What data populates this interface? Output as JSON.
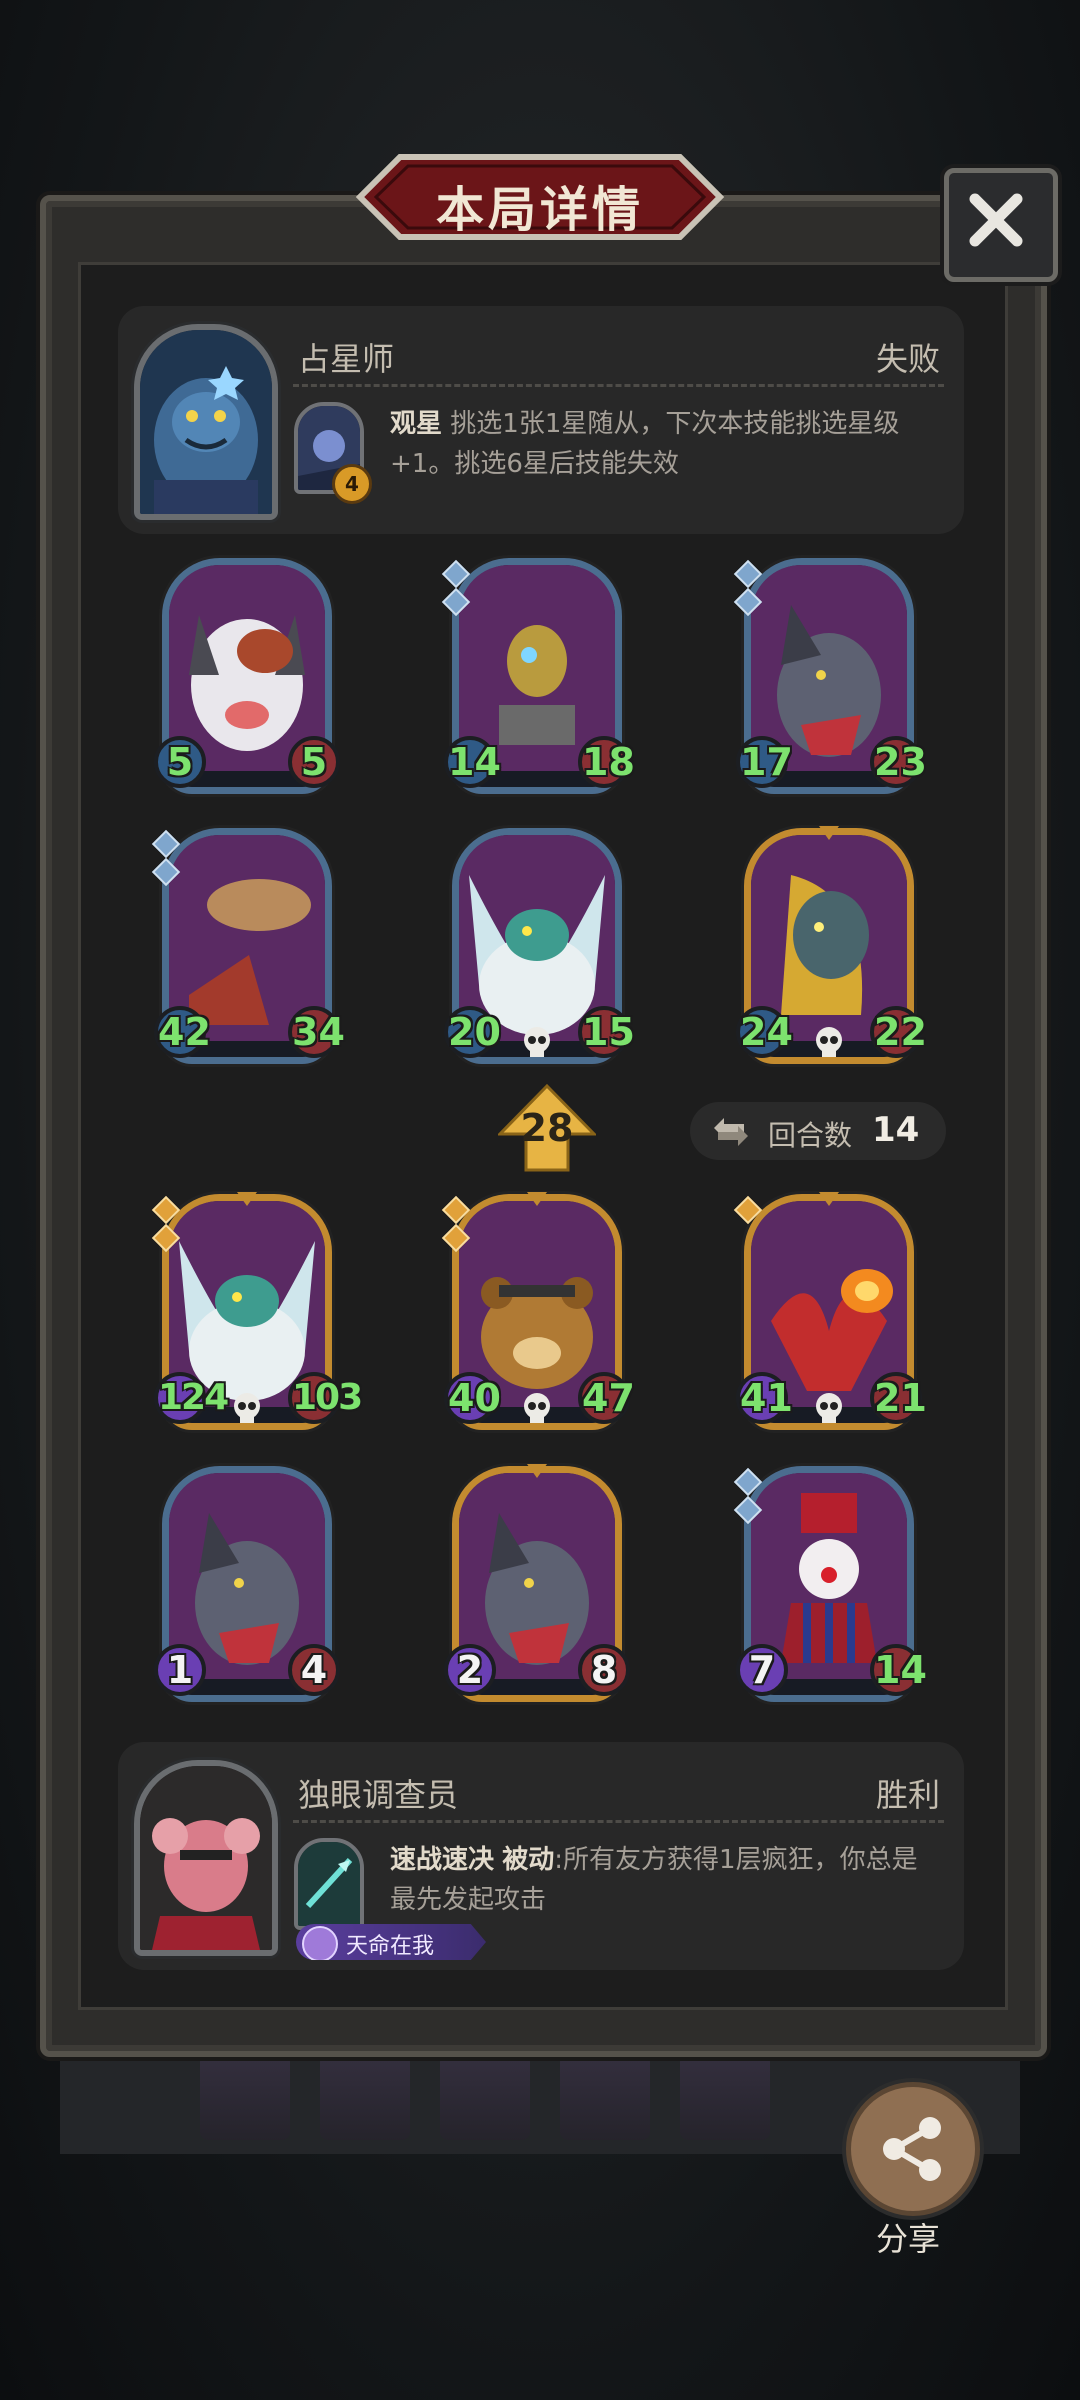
{
  "title": "本局详情",
  "opponent": {
    "name": "占星师",
    "result": "失败",
    "skill_name": "观星",
    "skill_desc": "挑选1张1星随从，下次本技能挑选星级+1。挑选6星后技能失效",
    "skill_level": "4"
  },
  "opponent_board": [
    {
      "atk": "5",
      "hp": "5",
      "frame": "blue",
      "gems": 0,
      "skull": false,
      "portrait": "wolf-dog"
    },
    {
      "atk": "14",
      "hp": "18",
      "frame": "blue",
      "gems": 2,
      "skull": false,
      "portrait": "robot-bug"
    },
    {
      "atk": "17",
      "hp": "23",
      "frame": "blue",
      "gems": 2,
      "skull": false,
      "portrait": "rat-bandit"
    },
    {
      "atk": "42",
      "hp": "34",
      "frame": "blue",
      "gems": 2,
      "skull": false,
      "portrait": "airship"
    },
    {
      "atk": "20",
      "hp": "15",
      "frame": "blue",
      "gems": 0,
      "skull": true,
      "portrait": "moth-yeti"
    },
    {
      "atk": "24",
      "hp": "22",
      "frame": "gold",
      "gems": 0,
      "skull": true,
      "portrait": "gold-dragon"
    }
  ],
  "arrow_value": "28",
  "rounds": {
    "label": "回合数",
    "value": "14"
  },
  "player_board": [
    {
      "atk": "124",
      "hp": "103",
      "frame": "gold",
      "gems": 2,
      "skull": true,
      "portrait": "moth-yeti"
    },
    {
      "atk": "40",
      "hp": "47",
      "frame": "gold",
      "gems": 2,
      "skull": true,
      "portrait": "bear"
    },
    {
      "atk": "41",
      "hp": "21",
      "frame": "gold",
      "gems": 1,
      "skull": true,
      "portrait": "fire-bat"
    },
    {
      "atk": "1",
      "hp": "4",
      "frame": "blue",
      "gems": 0,
      "skull": false,
      "portrait": "rat-bandit"
    },
    {
      "atk": "2",
      "hp": "8",
      "frame": "gold",
      "gems": 0,
      "skull": false,
      "portrait": "rat-bandit"
    },
    {
      "atk": "7",
      "hp": "14",
      "frame": "blue",
      "gems": 2,
      "skull": false,
      "portrait": "clown"
    }
  ],
  "player": {
    "name": "独眼调查员",
    "result": "胜利",
    "skill_name": "速战速决",
    "skill_tag": "被动",
    "skill_desc": ":所有友方获得1层疯狂，你总是最先发起攻击",
    "fate_badge": "天命在我"
  },
  "share_label": "分享",
  "colors": {
    "frame_blue": "#4b6d8f",
    "frame_gold": "#c38b2f",
    "stat_green": "#7de26e"
  }
}
